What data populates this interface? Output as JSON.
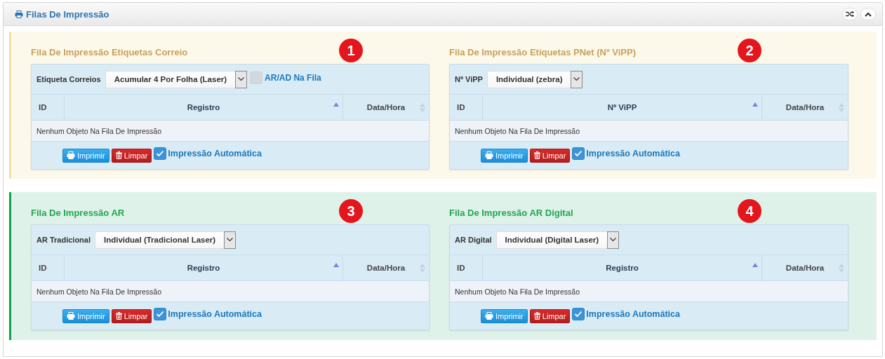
{
  "panel": {
    "title": "Filas De Impressão"
  },
  "sections": [
    {
      "kind": "warning",
      "queues": [
        {
          "title": "Fila De Impressão Etiquetas Correio",
          "badge": "1",
          "select_label": "Etiqueta Correios",
          "select_value": "Acumular 4 Por Folha (Laser)",
          "extra_option": {
            "label": "AR/AD Na Fila",
            "checked": false
          },
          "columns": [
            {
              "label": "ID",
              "sortable": false,
              "sorted": false
            },
            {
              "label": "Registro",
              "sortable": true,
              "sorted": true
            },
            {
              "label": "Data/Hora",
              "sortable": true,
              "sorted": false
            }
          ],
          "empty_message": "Nenhum Objeto Na Fila De Impressão",
          "buttons": [
            {
              "label": "Imprimir",
              "kind": "primary"
            },
            {
              "label": "Limpar",
              "kind": "danger"
            }
          ],
          "auto_print": {
            "label": "Impressão Automática",
            "checked": true
          }
        },
        {
          "title": "Fila De Impressão Etiquetas PNet (Nº ViPP)",
          "badge": "2",
          "select_label": "Nº ViPP",
          "select_value": "Individual (zebra)",
          "columns": [
            {
              "label": "ID",
              "sortable": false,
              "sorted": false
            },
            {
              "label": "Nº ViPP",
              "sortable": true,
              "sorted": true
            },
            {
              "label": "Data/Hora",
              "sortable": true,
              "sorted": false
            }
          ],
          "empty_message": "Nenhum Objeto Na Fila De Impressão",
          "buttons": [
            {
              "label": "Imprimir",
              "kind": "primary"
            },
            {
              "label": "Limpar",
              "kind": "danger"
            }
          ],
          "auto_print": {
            "label": "Impressão Automática",
            "checked": true
          }
        }
      ]
    },
    {
      "kind": "success",
      "queues": [
        {
          "title": "Fila De Impressão AR",
          "badge": "3",
          "select_label": "AR Tradicional",
          "select_value": "Individual (Tradicional Laser)",
          "columns": [
            {
              "label": "ID",
              "sortable": false,
              "sorted": false
            },
            {
              "label": "Registro",
              "sortable": true,
              "sorted": true
            },
            {
              "label": "Data/Hora",
              "sortable": true,
              "sorted": false
            }
          ],
          "empty_message": "Nenhum Objeto Na Fila De Impressão",
          "buttons": [
            {
              "label": "Imprimir",
              "kind": "primary"
            },
            {
              "label": "Limpar",
              "kind": "danger"
            }
          ],
          "auto_print": {
            "label": "Impressão Automática",
            "checked": true
          }
        },
        {
          "title": "Fila De Impressão AR Digital",
          "badge": "4",
          "select_label": "AR Digital",
          "select_value": "Individual (Digital Laser)",
          "columns": [
            {
              "label": "ID",
              "sortable": false,
              "sorted": false
            },
            {
              "label": "Registro",
              "sortable": true,
              "sorted": true
            },
            {
              "label": "Data/Hora",
              "sortable": true,
              "sorted": false
            }
          ],
          "empty_message": "Nenhum Objeto Na Fila De Impressão",
          "buttons": [
            {
              "label": "Imprimir",
              "kind": "primary"
            },
            {
              "label": "Limpar",
              "kind": "danger"
            }
          ],
          "auto_print": {
            "label": "Impressão Automática",
            "checked": true
          }
        }
      ]
    }
  ]
}
